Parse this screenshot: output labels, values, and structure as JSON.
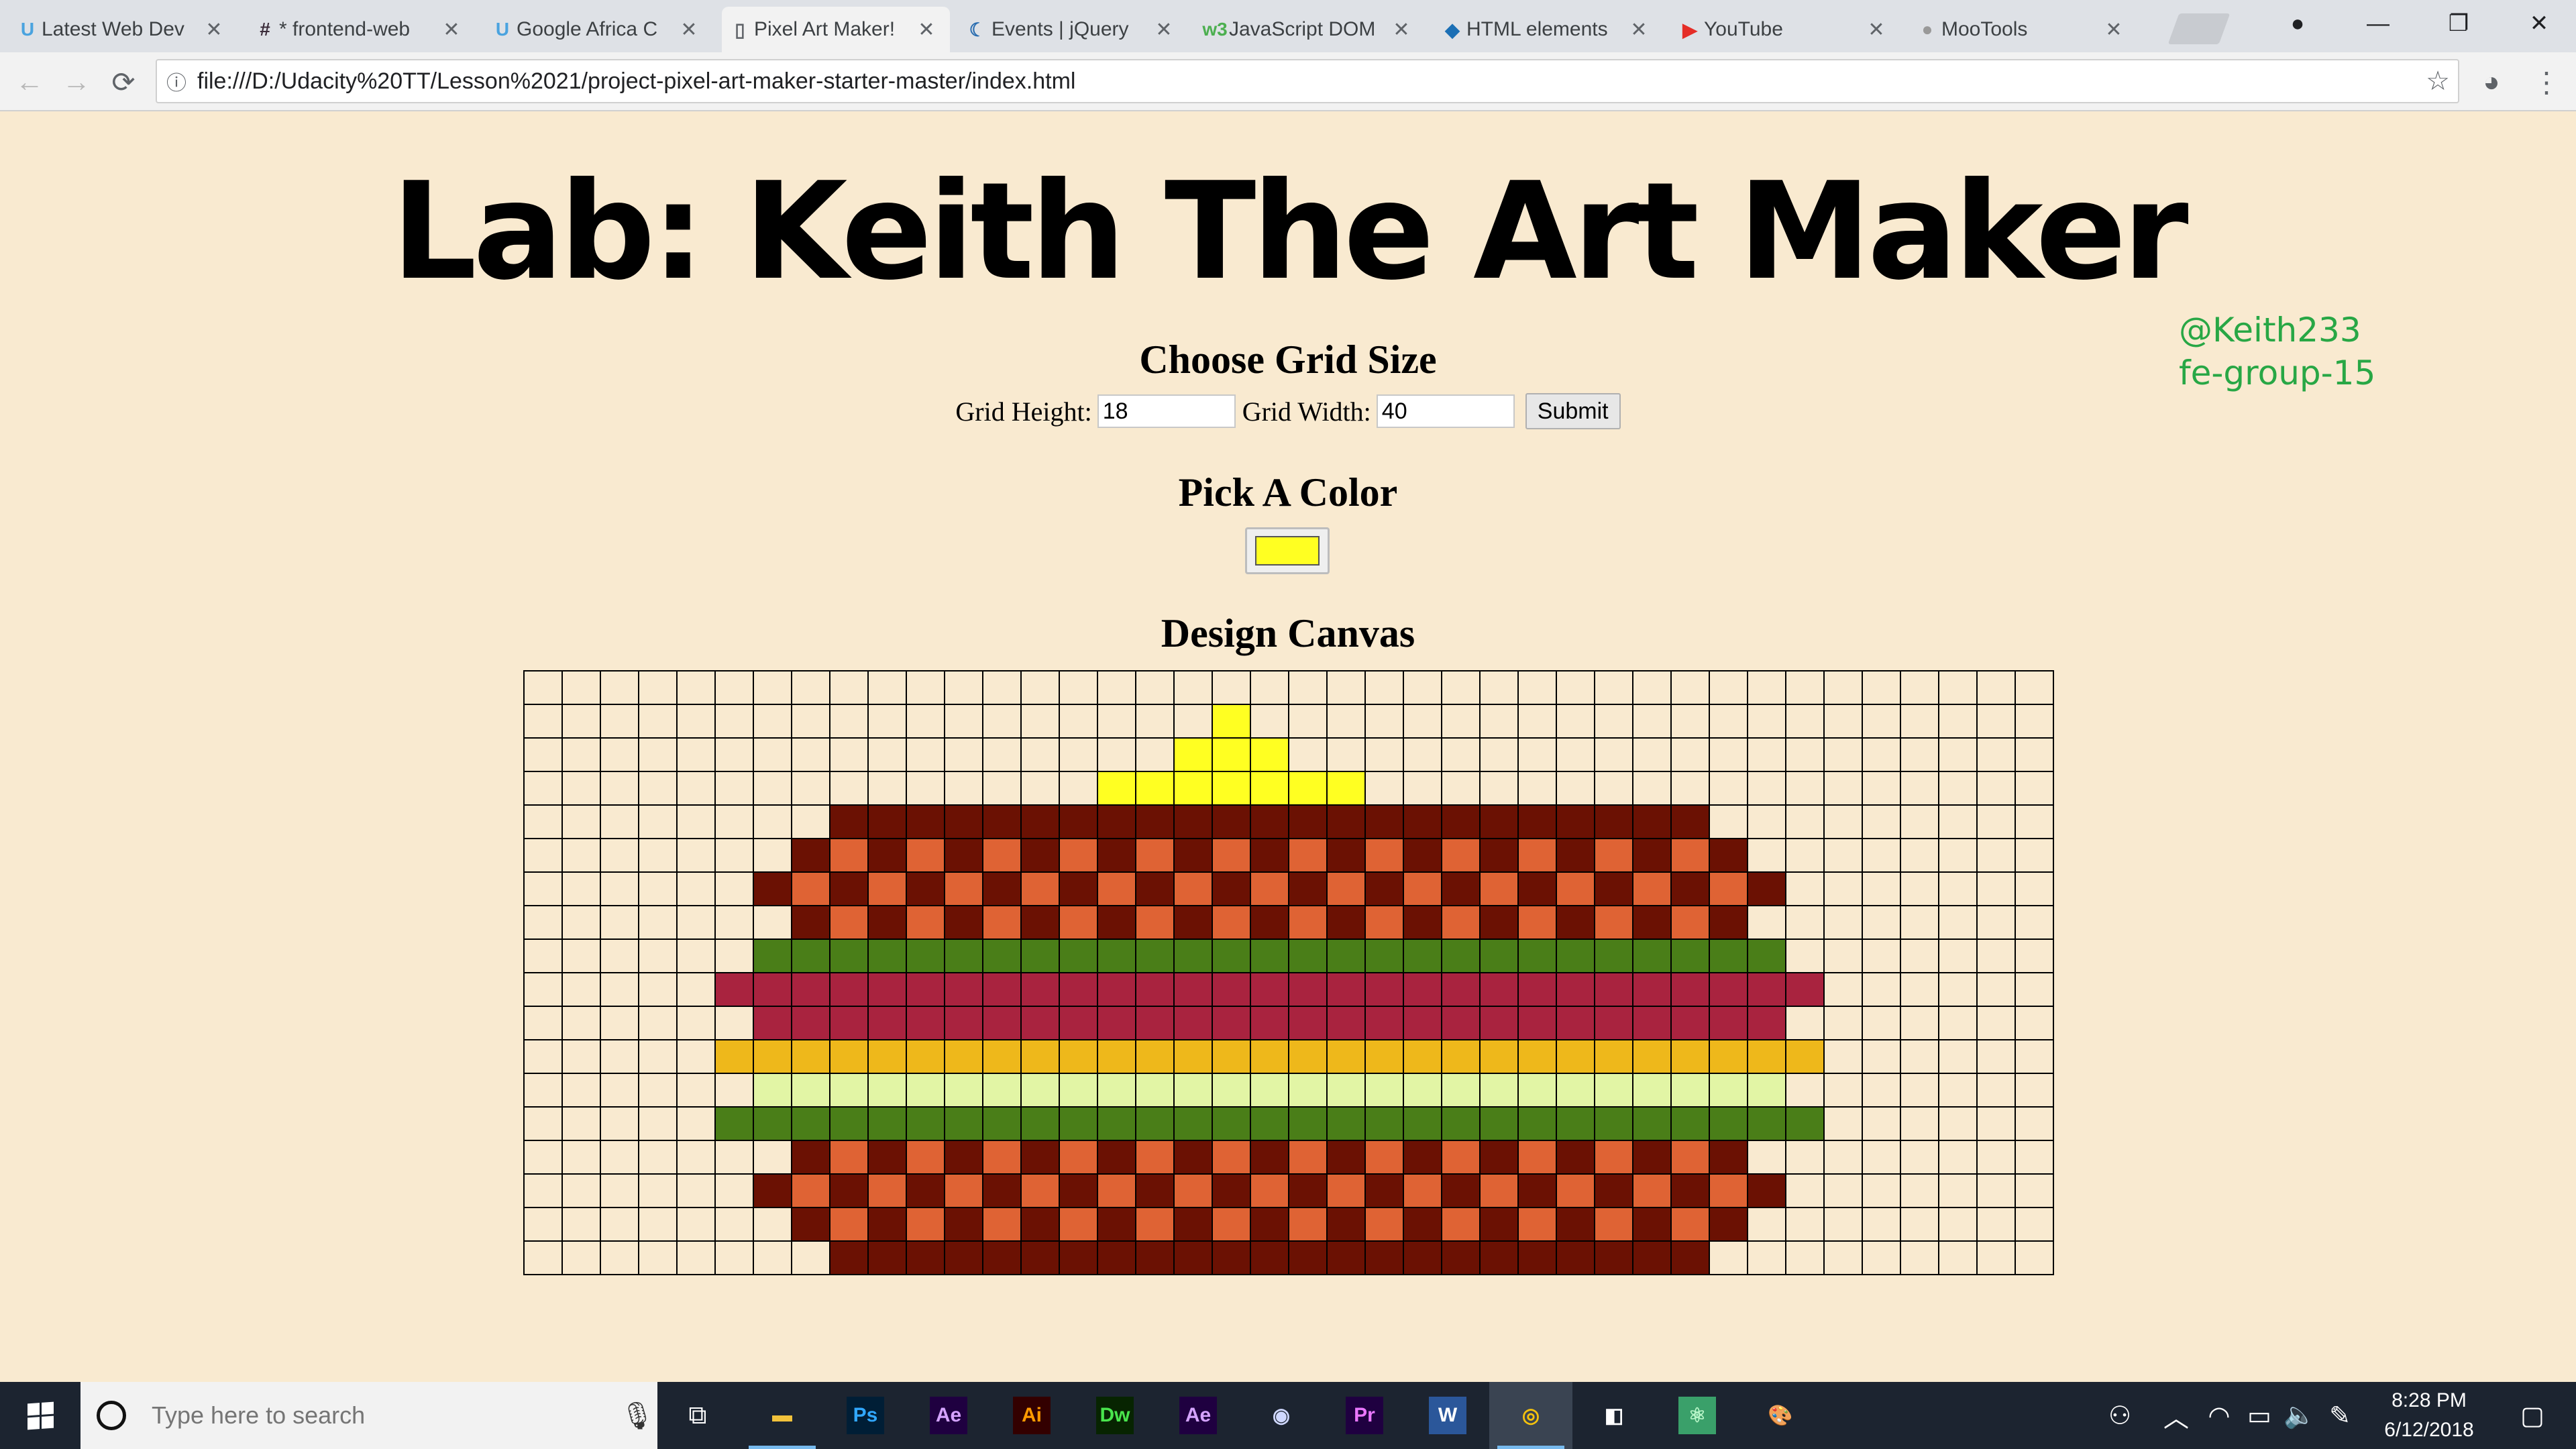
{
  "browser": {
    "tabs": [
      {
        "label": "Latest Web Dev",
        "icon": "udacity-icon",
        "color": "#4aa3df",
        "glyph": "U"
      },
      {
        "label": "* frontend-web",
        "icon": "slack-icon",
        "color": "#3b2c3a",
        "glyph": "#"
      },
      {
        "label": "Google Africa C",
        "icon": "udacity-icon",
        "color": "#4aa3df",
        "glyph": "U"
      },
      {
        "label": "Pixel Art Maker!",
        "icon": "file-icon",
        "color": "#5f6368",
        "glyph": "▯",
        "active": true
      },
      {
        "label": "Events | jQuery",
        "icon": "jquery-icon",
        "color": "#2a6db0",
        "glyph": "☾"
      },
      {
        "label": "JavaScript DOM",
        "icon": "w3schools-icon",
        "color": "#4caf50",
        "glyph": "w3"
      },
      {
        "label": "HTML elements",
        "icon": "mdn-icon",
        "color": "#1b6fb5",
        "glyph": "◆"
      },
      {
        "label": "YouTube",
        "icon": "youtube-icon",
        "color": "#e52d27",
        "glyph": "▶"
      },
      {
        "label": "MooTools",
        "icon": "mootools-icon",
        "color": "#999999",
        "glyph": "●"
      }
    ],
    "url": "file:///D:/Udacity%20TT/Lesson%2021/project-pixel-art-maker-starter-master/index.html"
  },
  "page": {
    "title": "Lab: Keith The Art Maker",
    "handle": "@Keith233",
    "group": "fe-group-15",
    "grid_size_heading": "Choose Grid Size",
    "height_label": "Grid Height:",
    "height_value": "18",
    "width_label": "Grid Width:",
    "width_value": "40",
    "submit_label": "Submit",
    "color_heading": "Pick A Color",
    "selected_color": "#ffff22",
    "canvas_heading": "Design Canvas"
  },
  "canvas": {
    "rows": 18,
    "cols": 40,
    "palette": {
      "B": "#6b1103",
      "O": "#df6334",
      "Y": "#ffff22",
      "G": "#4a7e18",
      "R": "#a9233f",
      "M": "#eeb81b",
      "L": "#e2f5a5"
    },
    "cells": [
      "........................................",
      "..................Y.....................",
      ".................YYY....................",
      "...............YYYYYYY..................",
      "........BBBBBBBBBBBBBBBBBBBBBBB.........",
      ".......BOBOBOBOBOBOBOBOBOBOBOBOB........",
      "......BOBOBOBOBOBOBOBOBOBOBOBOBOB.......",
      ".......BOBOBOBOBOBOBOBOBOBOBOBOB........",
      "......GGGGGGGGGGGGGGGGGGGGGGGGGGG.......",
      ".....RRRRRRRRRRRRRRRRRRRRRRRRRRRRR......",
      "......RRRRRRRRRRRRRRRRRRRRRRRRRRR.......",
      ".....MMMMMMMMMMMMMMMMMMMMMMMMMMMMM......",
      "......LLLLLLLLLLLLLLLLLLLLLLLLLLL.......",
      ".....GGGGGGGGGGGGGGGGGGGGGGGGGGGGG......",
      ".......BOBOBOBOBOBOBOBOBOBOBOBOB........",
      "......BOBOBOBOBOBOBOBOBOBOBOBOBOB.......",
      ".......BOBOBOBOBOBOBOBOBOBOBOBOB........",
      "........BBBBBBBBBBBBBBBBBBBBBBB........."
    ]
  },
  "taskbar": {
    "search_placeholder": "Type here to search",
    "apps": [
      {
        "name": "file-explorer",
        "glyph": "▬",
        "fg": "#f2c23b",
        "bg": "transparent",
        "bar": true
      },
      {
        "name": "photoshop",
        "glyph": "Ps",
        "fg": "#31a8ff",
        "bg": "#001e36"
      },
      {
        "name": "after-effects",
        "glyph": "Ae",
        "fg": "#d5a3ff",
        "bg": "#1f0040"
      },
      {
        "name": "illustrator",
        "glyph": "Ai",
        "fg": "#ff9a00",
        "bg": "#330000"
      },
      {
        "name": "dreamweaver",
        "glyph": "Dw",
        "fg": "#49e54d",
        "bg": "#072401"
      },
      {
        "name": "after-effects-2",
        "glyph": "Ae",
        "fg": "#d5a3ff",
        "bg": "#1f0040"
      },
      {
        "name": "cinema4d",
        "glyph": "◉",
        "fg": "#cfd8ff",
        "bg": "transparent"
      },
      {
        "name": "premiere",
        "glyph": "Pr",
        "fg": "#ea77ff",
        "bg": "#1f0040"
      },
      {
        "name": "word",
        "glyph": "W",
        "fg": "#ffffff",
        "bg": "#2b579a"
      },
      {
        "name": "chrome",
        "glyph": "◎",
        "fg": "#f4c20d",
        "bg": "transparent",
        "active": true
      },
      {
        "name": "sticky-notes",
        "glyph": "◧",
        "fg": "#ffffff",
        "bg": "transparent"
      },
      {
        "name": "atom",
        "glyph": "⚛",
        "fg": "#b8f5c8",
        "bg": "#3aa06a"
      },
      {
        "name": "paint",
        "glyph": "🎨",
        "fg": "#ffffff",
        "bg": "transparent"
      }
    ],
    "time": "8:28 PM",
    "date": "6/12/2018"
  }
}
